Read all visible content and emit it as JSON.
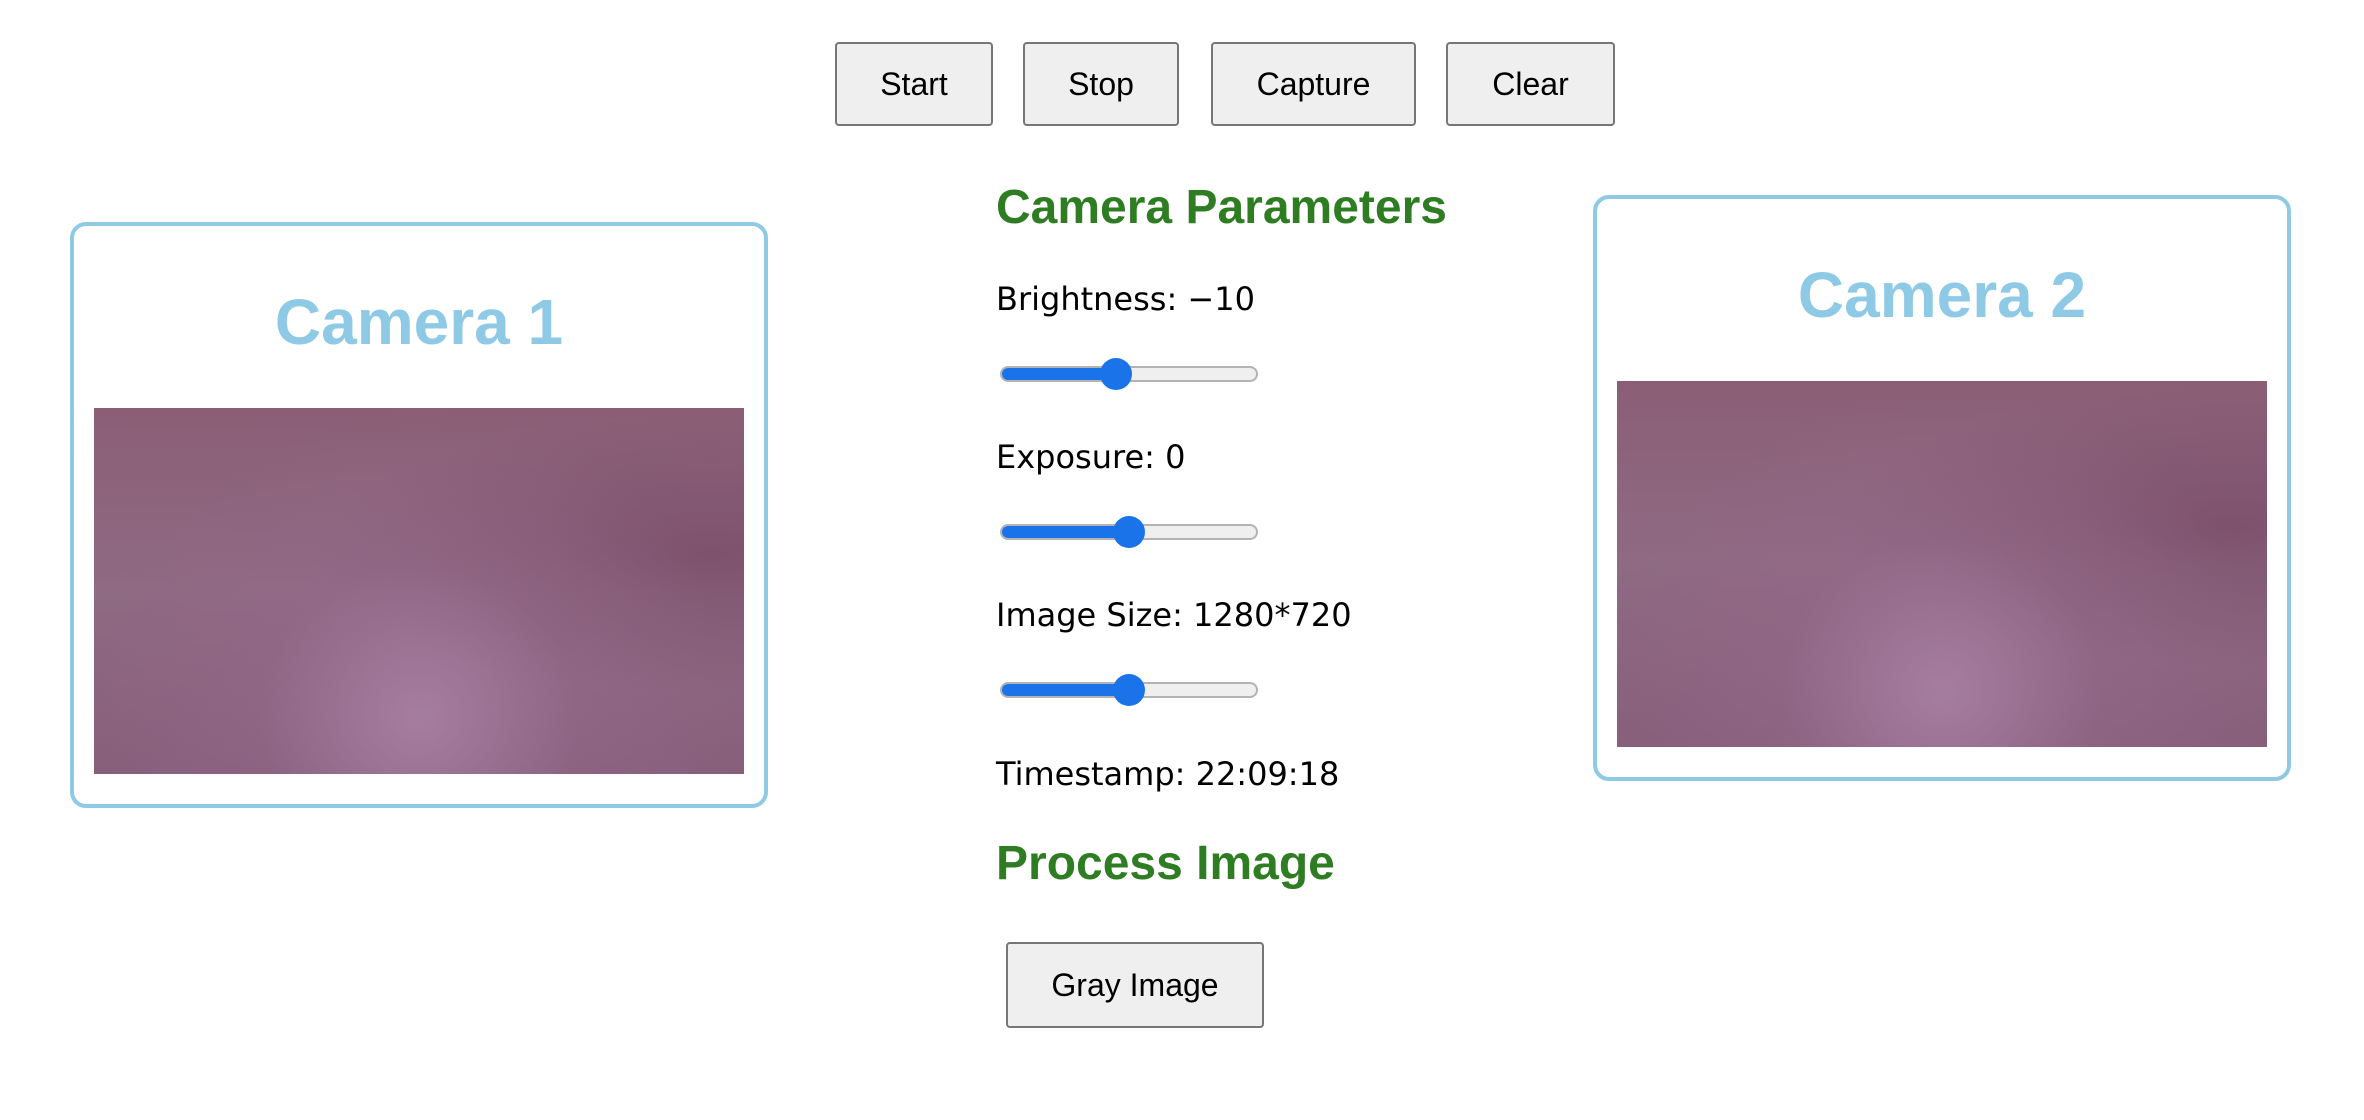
{
  "toolbar": {
    "start_label": "Start",
    "stop_label": "Stop",
    "capture_label": "Capture",
    "clear_label": "Clear"
  },
  "camera1": {
    "title": "Camera 1"
  },
  "camera2": {
    "title": "Camera 2"
  },
  "params": {
    "title": "Camera Parameters",
    "brightness": {
      "label": "Brightness: −10",
      "fraction": 0.45
    },
    "exposure": {
      "label": "Exposure: 0",
      "fraction": 0.5
    },
    "image_size": {
      "label": "Image Size: 1280*720",
      "fraction": 0.5
    },
    "timestamp": {
      "label": "Timestamp: 22:09:18"
    }
  },
  "process": {
    "title": "Process Image",
    "gray_label": "Gray Image"
  },
  "colors": {
    "accent": "#1a73e8",
    "camera_border": "#8ecae6",
    "section_title": "#2e7d22"
  }
}
